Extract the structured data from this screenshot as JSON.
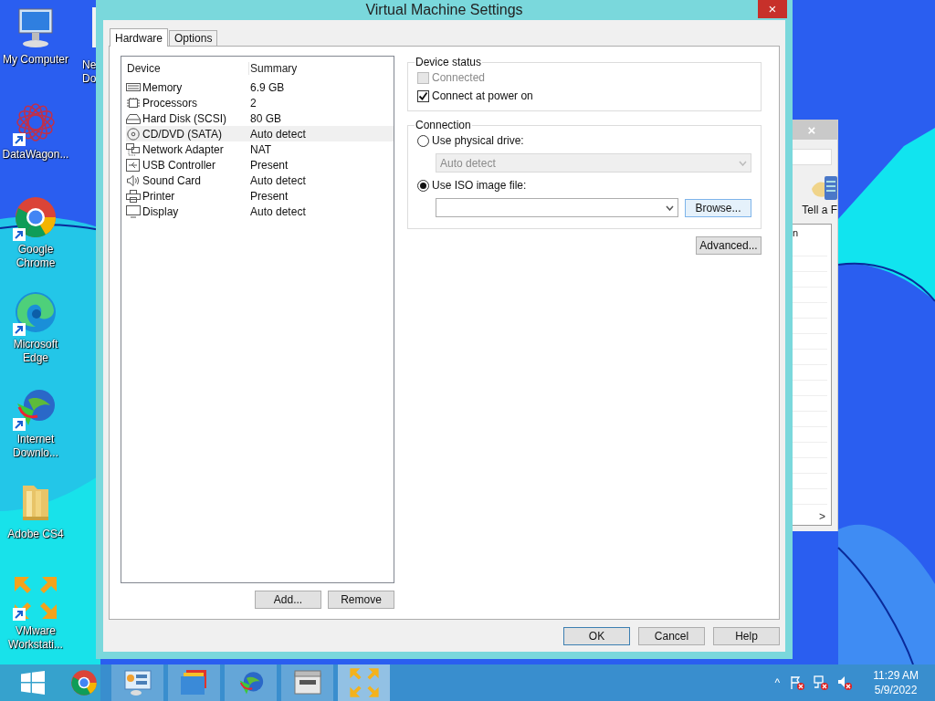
{
  "desktop_icons": [
    {
      "label": "My Computer",
      "kind": "computer",
      "shortcut": false
    },
    {
      "label": "DataWagon...",
      "kind": "datawagon",
      "shortcut": true
    },
    {
      "label": "Google Chrome",
      "kind": "chrome",
      "shortcut": true
    },
    {
      "label": "Microsoft Edge",
      "kind": "edge",
      "shortcut": true
    },
    {
      "label": "Internet Downlo...",
      "kind": "downloader",
      "shortcut": true
    },
    {
      "label": "Adobe CS4",
      "kind": "folder",
      "shortcut": false
    },
    {
      "label": "VMware Workstati...",
      "kind": "vmware",
      "shortcut": true
    }
  ],
  "partial_desktop_icon": {
    "label": "Ne Do"
  },
  "background_window": {
    "close": "×",
    "toolbar_label": "Tell a F",
    "column_header": "n",
    "scroll_arrow": ">"
  },
  "window": {
    "title": "Virtual Machine Settings",
    "close": "×",
    "tabs": [
      {
        "label": "Hardware",
        "selected": true
      },
      {
        "label": "Options",
        "selected": false
      }
    ],
    "device_table": {
      "columns": [
        "Device",
        "Summary"
      ],
      "rows": [
        {
          "kind": "memory",
          "device": "Memory",
          "summary": "6.9 GB",
          "selected": false
        },
        {
          "kind": "processor",
          "device": "Processors",
          "summary": "2",
          "selected": false
        },
        {
          "kind": "disk",
          "device": "Hard Disk (SCSI)",
          "summary": "80 GB",
          "selected": false
        },
        {
          "kind": "cd",
          "device": "CD/DVD (SATA)",
          "summary": "Auto detect",
          "selected": true
        },
        {
          "kind": "network",
          "device": "Network Adapter",
          "summary": "NAT",
          "selected": false
        },
        {
          "kind": "usb",
          "device": "USB Controller",
          "summary": "Present",
          "selected": false
        },
        {
          "kind": "sound",
          "device": "Sound Card",
          "summary": "Auto detect",
          "selected": false
        },
        {
          "kind": "printer",
          "device": "Printer",
          "summary": "Present",
          "selected": false
        },
        {
          "kind": "display",
          "device": "Display",
          "summary": "Auto detect",
          "selected": false
        }
      ]
    },
    "list_buttons": [
      "Add...",
      "Remove"
    ],
    "device_status": {
      "title": "Device status",
      "options": [
        {
          "label": "Connected",
          "checked": false,
          "disabled": true
        },
        {
          "label": "Connect at power on",
          "checked": true,
          "disabled": false
        }
      ]
    },
    "connection": {
      "title": "Connection",
      "physical_drive": {
        "label": "Use physical drive:",
        "selected": false,
        "value": "Auto detect",
        "disabled": true
      },
      "iso_image": {
        "label": "Use ISO image file:",
        "selected": true,
        "browse": "Browse..."
      }
    },
    "advanced_button": "Advanced...",
    "footer_buttons": [
      {
        "label": "OK",
        "default": true
      },
      {
        "label": "Cancel",
        "default": false
      },
      {
        "label": "Help",
        "default": false
      }
    ]
  },
  "taskbar": {
    "items": [
      {
        "kind": "start",
        "running": false,
        "active": false
      },
      {
        "kind": "chrome",
        "running": false,
        "active": false
      },
      {
        "kind": "control-panel",
        "running": true,
        "active": false
      },
      {
        "kind": "folders",
        "running": true,
        "active": false
      },
      {
        "kind": "downloader",
        "running": true,
        "active": false
      },
      {
        "kind": "adobe",
        "running": true,
        "active": false
      },
      {
        "kind": "vmware",
        "running": true,
        "active": true
      }
    ],
    "tray": {
      "expand": "^",
      "time": "11:29 AM",
      "date": "5/9/2022"
    }
  }
}
